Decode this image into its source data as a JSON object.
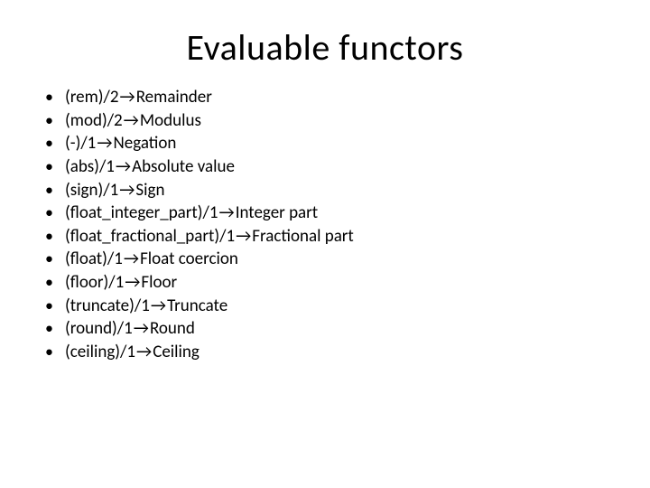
{
  "title": "Evaluable functors",
  "arrow_glyph": "→",
  "items": [
    {
      "functor": "(rem)/2",
      "desc": "Remainder"
    },
    {
      "functor": "(mod)/2",
      "desc": "Modulus"
    },
    {
      "functor": "(-)/1",
      "desc": "Negation"
    },
    {
      "functor": "(abs)/1",
      "desc": "Absolute value"
    },
    {
      "functor": "(sign)/1",
      "desc": "Sign"
    },
    {
      "functor": "(float_integer_part)/1",
      "desc": "Integer part"
    },
    {
      "functor": "(float_fractional_part)/1",
      "desc": "Fractional part"
    },
    {
      "functor": "(float)/1",
      "desc": "Float coercion"
    },
    {
      "functor": "(floor)/1",
      "desc": "Floor"
    },
    {
      "functor": "(truncate)/1",
      "desc": "Truncate"
    },
    {
      "functor": "(round)/1",
      "desc": "Round"
    },
    {
      "functor": "(ceiling)/1",
      "desc": "Ceiling"
    }
  ]
}
